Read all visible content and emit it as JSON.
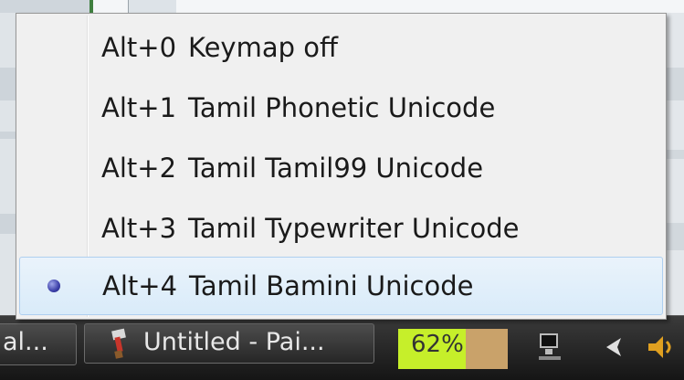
{
  "taskbar": {
    "left_button_label": "al...",
    "paint_button_label": "Untitled - Pai...",
    "battery_percent_label": "62%",
    "battery_level": 0.62,
    "paint_icon": "paintbrush-icon",
    "tray_icons": [
      "network-icon",
      "arrow-icon",
      "speaker-icon"
    ]
  },
  "menu": {
    "items": [
      {
        "shortcut": "Alt+0",
        "label": "Keymap off",
        "selected": false
      },
      {
        "shortcut": "Alt+1",
        "label": "Tamil Phonetic Unicode",
        "selected": false
      },
      {
        "shortcut": "Alt+2",
        "label": "Tamil Tamil99 Unicode",
        "selected": false
      },
      {
        "shortcut": "Alt+3",
        "label": "Tamil Typewriter Unicode",
        "selected": false
      },
      {
        "shortcut": "Alt+4",
        "label": "Tamil Bamini Unicode",
        "selected": true
      }
    ],
    "radio_icon": "radio-selected-icon",
    "colors": {
      "background": "#f0f0f0",
      "selected_border": "#aecff0",
      "radio": "#3b3fa8"
    }
  }
}
